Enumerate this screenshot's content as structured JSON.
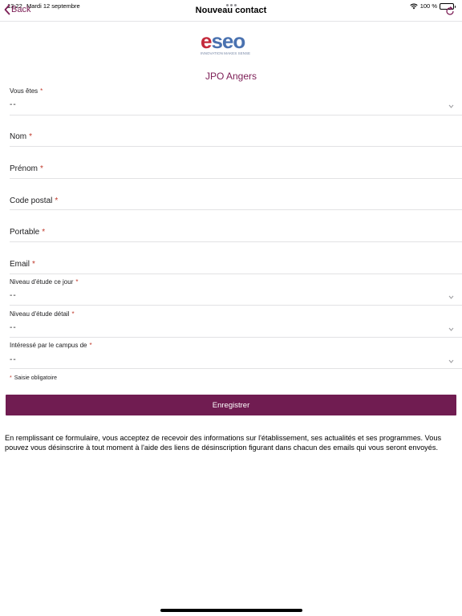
{
  "status_bar": {
    "time": "13:22",
    "date": "Mardi 12 septembre",
    "battery": "100 %",
    "icons": [
      "wifi-icon",
      "battery-icon"
    ]
  },
  "nav": {
    "back_label": "Back",
    "title": "Nouveau contact",
    "icons": [
      "chevron-left-icon",
      "refresh-icon"
    ]
  },
  "logo": {
    "text": "eseo",
    "tagline": "INNOVATION MAKES SENSE"
  },
  "event_title": "JPO Angers",
  "form": {
    "vous_etes": {
      "label": "Vous êtes",
      "value": "--"
    },
    "nom": {
      "label": "Nom"
    },
    "prenom": {
      "label": "Prénom"
    },
    "code_postal": {
      "label": "Code postal"
    },
    "portable": {
      "label": "Portable"
    },
    "email": {
      "label": "Email"
    },
    "niveau_jour": {
      "label": "Niveau d'étude ce jour",
      "value": "--"
    },
    "niveau_detail": {
      "label": "Niveau d'étude détail",
      "value": "--"
    },
    "campus": {
      "label": "Intéressé par le campus de",
      "value": "--"
    },
    "required_star": "*",
    "required_note": "Saisie obligatoire"
  },
  "save_label": "Enregistrer",
  "consent_text": "En remplissant ce formulaire, vous acceptez de recevoir des informations sur l'établissement, ses actualités et ses programmes. Vous pouvez vous désinscrire à tout moment à l'aide des liens de désinscription figurant dans chacun des emails qui vous seront envoyés.",
  "colors": {
    "accent": "#7c1d55",
    "button": "#701c51",
    "required": "#c0392b",
    "logo_red": "#c42a3c",
    "logo_blue": "#4a72b0"
  }
}
